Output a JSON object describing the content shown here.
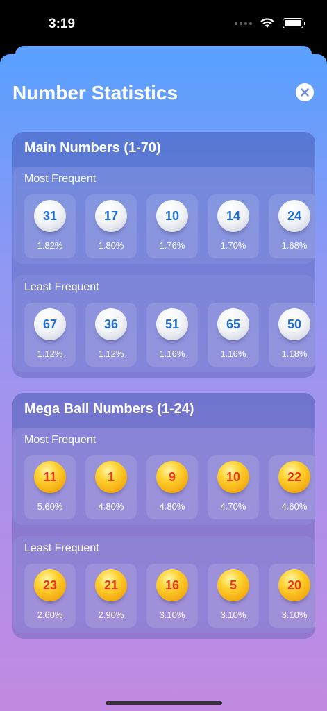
{
  "status_bar": {
    "time": "3:19"
  },
  "sheet": {
    "title": "Number Statistics",
    "close_icon": "close-x-icon"
  },
  "sections": [
    {
      "title": "Main Numbers (1-70)",
      "ball_style": "white",
      "groups": [
        {
          "title": "Most Frequent",
          "balls": [
            {
              "number": "31",
              "pct": "1.82%"
            },
            {
              "number": "17",
              "pct": "1.80%"
            },
            {
              "number": "10",
              "pct": "1.76%"
            },
            {
              "number": "14",
              "pct": "1.70%"
            },
            {
              "number": "24",
              "pct": "1.68%"
            }
          ]
        },
        {
          "title": "Least Frequent",
          "balls": [
            {
              "number": "67",
              "pct": "1.12%"
            },
            {
              "number": "36",
              "pct": "1.12%"
            },
            {
              "number": "51",
              "pct": "1.16%"
            },
            {
              "number": "65",
              "pct": "1.16%"
            },
            {
              "number": "50",
              "pct": "1.18%"
            }
          ]
        }
      ]
    },
    {
      "title": "Mega Ball Numbers (1-24)",
      "ball_style": "gold",
      "groups": [
        {
          "title": "Most Frequent",
          "balls": [
            {
              "number": "11",
              "pct": "5.60%"
            },
            {
              "number": "1",
              "pct": "4.80%"
            },
            {
              "number": "9",
              "pct": "4.80%"
            },
            {
              "number": "10",
              "pct": "4.70%"
            },
            {
              "number": "22",
              "pct": "4.60%"
            }
          ]
        },
        {
          "title": "Least Frequent",
          "balls": [
            {
              "number": "23",
              "pct": "2.60%"
            },
            {
              "number": "21",
              "pct": "2.90%"
            },
            {
              "number": "16",
              "pct": "3.10%"
            },
            {
              "number": "5",
              "pct": "3.10%"
            },
            {
              "number": "20",
              "pct": "3.10%"
            }
          ]
        }
      ]
    }
  ],
  "colors": {
    "white_ball_text": "#1e6fd8",
    "gold_ball_text": "#e8391f",
    "gradient_top": "#59a0ff",
    "gradient_bottom": "#c18ae2"
  }
}
